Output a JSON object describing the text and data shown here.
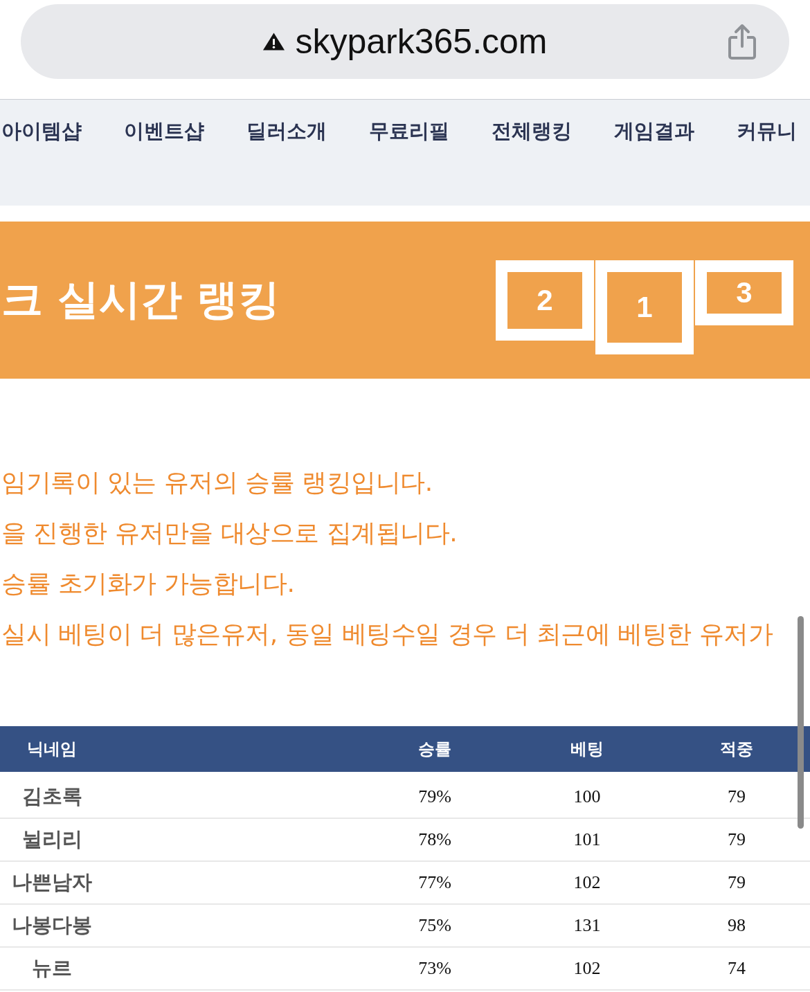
{
  "address_bar": {
    "url": "skypark365.com"
  },
  "nav_items": [
    "아이템샵",
    "이벤트샵",
    "딜러소개",
    "무료리필",
    "전체랭킹",
    "게임결과",
    "커뮤니"
  ],
  "banner": {
    "title": "크 실시간 랭킹",
    "podium": [
      {
        "label": "2",
        "kind": "second"
      },
      {
        "label": "1",
        "kind": "first"
      },
      {
        "label": "3",
        "kind": "third"
      }
    ]
  },
  "notes": [
    "임기록이 있는 유저의 승률 랭킹입니다.",
    "을 진행한 유저만을 대상으로 집계됩니다.",
    "승률 초기화가 가능합니다.",
    "실시 베팅이 더 많은유저, 동일 베팅수일 경우 더 최근에 베팅한 유저가"
  ],
  "table": {
    "columns": [
      "닉네임",
      "승률",
      "베팅",
      "적중"
    ],
    "rows": [
      [
        "김초록",
        "79%",
        "100",
        "79"
      ],
      [
        "뉠리리",
        "78%",
        "101",
        "79"
      ],
      [
        "나쁜남자",
        "77%",
        "102",
        "79"
      ],
      [
        "나봉다봉",
        "75%",
        "131",
        "98"
      ],
      [
        "뉴르",
        "73%",
        "102",
        "74"
      ]
    ]
  }
}
